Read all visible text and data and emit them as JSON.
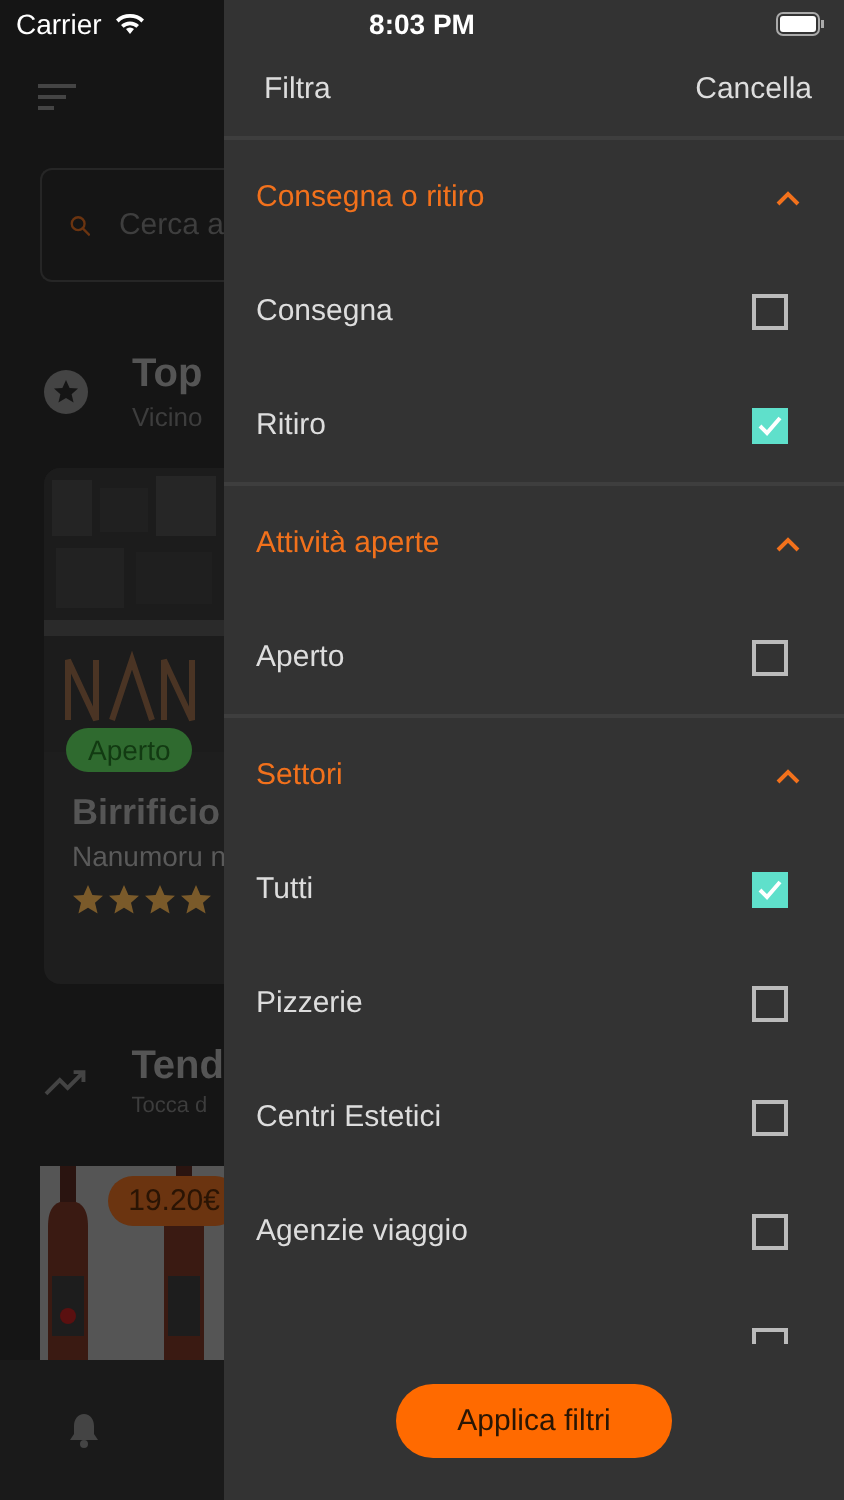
{
  "status_bar": {
    "carrier": "Carrier",
    "time": "8:03 PM"
  },
  "home": {
    "search": {
      "placeholder": "Cerca a"
    },
    "top": {
      "title": "Top",
      "subtitle": "Vicino"
    },
    "shop": {
      "badge": "Aperto",
      "open": true,
      "name": "Birrificio",
      "subtitle": "Nanumoru n",
      "stars": 4
    },
    "trending": {
      "title": "Tend",
      "subtitle": "Tocca d"
    },
    "product": {
      "price": "19.20€"
    }
  },
  "filter": {
    "title": "Filtra",
    "cancel": "Cancella",
    "sections": [
      {
        "title": "Consegna o ritiro",
        "expanded": true,
        "options": [
          {
            "label": "Consegna",
            "checked": false
          },
          {
            "label": "Ritiro",
            "checked": true
          }
        ]
      },
      {
        "title": "Attività aperte",
        "expanded": true,
        "options": [
          {
            "label": "Aperto",
            "checked": false
          }
        ]
      },
      {
        "title": "Settori",
        "expanded": true,
        "options": [
          {
            "label": "Tutti",
            "checked": true
          },
          {
            "label": "Pizzerie",
            "checked": false
          },
          {
            "label": "Centri Estetici",
            "checked": false
          },
          {
            "label": "Agenzie viaggio",
            "checked": false
          },
          {
            "checked": false
          }
        ]
      }
    ],
    "apply": "Applica filtri"
  }
}
